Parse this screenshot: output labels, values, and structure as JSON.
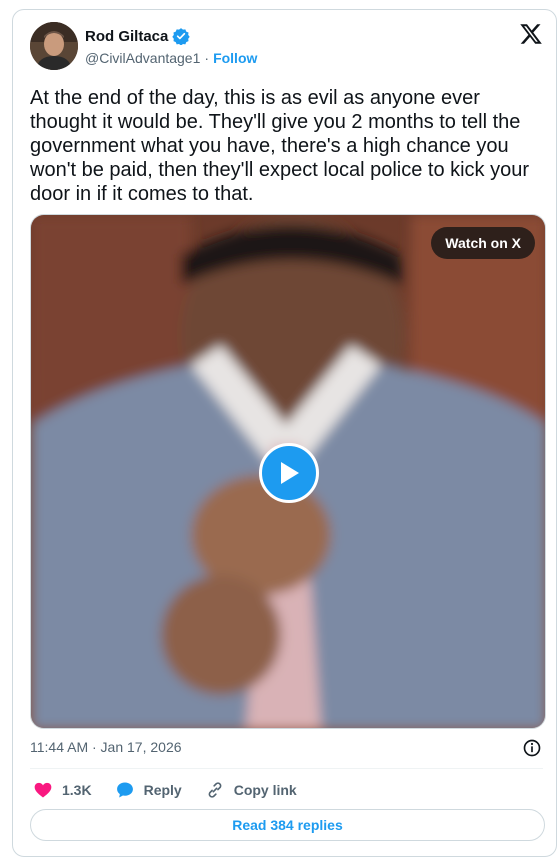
{
  "author": {
    "name": "Rod Giltaca",
    "handle": "@CivilAdvantage1",
    "separator": "·",
    "follow_label": "Follow",
    "verified": true
  },
  "tweet": {
    "text": "At the end of the day, this is as evil as anyone ever thought it would be. They'll give you 2 months to tell the government what you have, there's a high chance you won't be paid, then they'll expect local police to kick your door in if it comes to that.",
    "timestamp": "11:44 AM · Jan 17, 2026"
  },
  "media": {
    "watch_label": "Watch on X",
    "play_icon": "play-icon"
  },
  "actions": {
    "like_count": "1.3K",
    "reply_label": "Reply",
    "copy_link_label": "Copy link",
    "read_replies_label": "Read 384 replies"
  },
  "colors": {
    "accent": "#1d9bf0",
    "like": "#f91880",
    "text": "#0f1419",
    "muted": "#536471"
  }
}
